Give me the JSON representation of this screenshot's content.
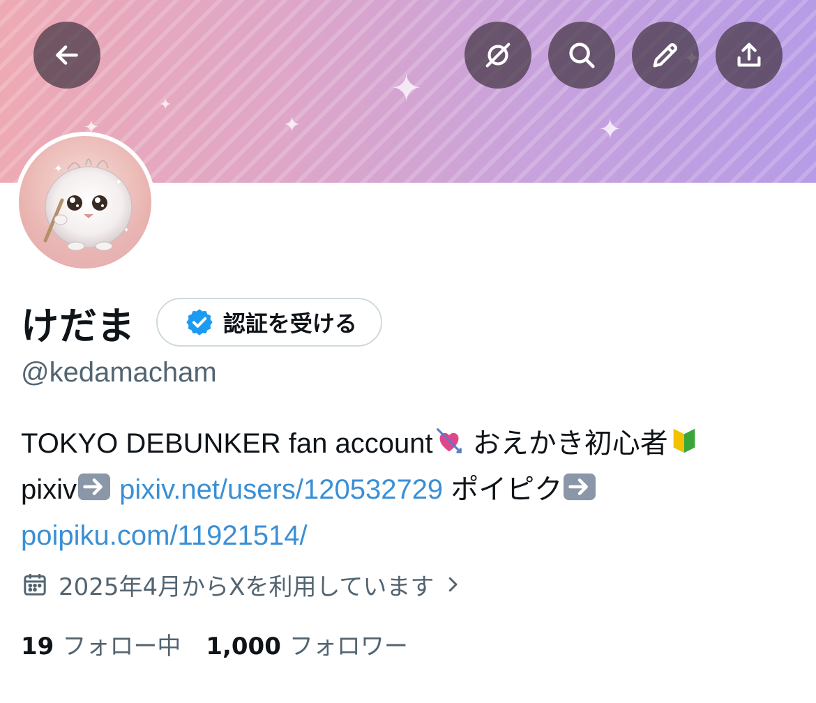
{
  "header": {
    "back_icon": "arrow-left-icon",
    "actions": [
      {
        "name": "grok-icon"
      },
      {
        "name": "search-icon"
      },
      {
        "name": "edit-icon"
      },
      {
        "name": "share-icon"
      }
    ]
  },
  "profile": {
    "display_name": "けだま",
    "verify_button_label": "認証を受ける",
    "handle": "@kedamacham",
    "bio": {
      "line1": "TOKYO DEBUNKER fan account",
      "line1b": "おえかき初心者",
      "line2_prefix": "pixiv",
      "pixiv_link": "pixiv.net/users/120532729",
      "line2_mid": "ポイピク",
      "poipiku_link": "poipiku.com/11921514/"
    },
    "joined": "2025年4月からXを利用しています",
    "following_count": "19",
    "following_label": "フォロー中",
    "followers_count": "1,000",
    "followers_label": "フォロワー"
  },
  "colors": {
    "accent": "#1d9bf0",
    "link": "#3a8fd6",
    "muted": "#536471",
    "text": "#0f1419"
  }
}
